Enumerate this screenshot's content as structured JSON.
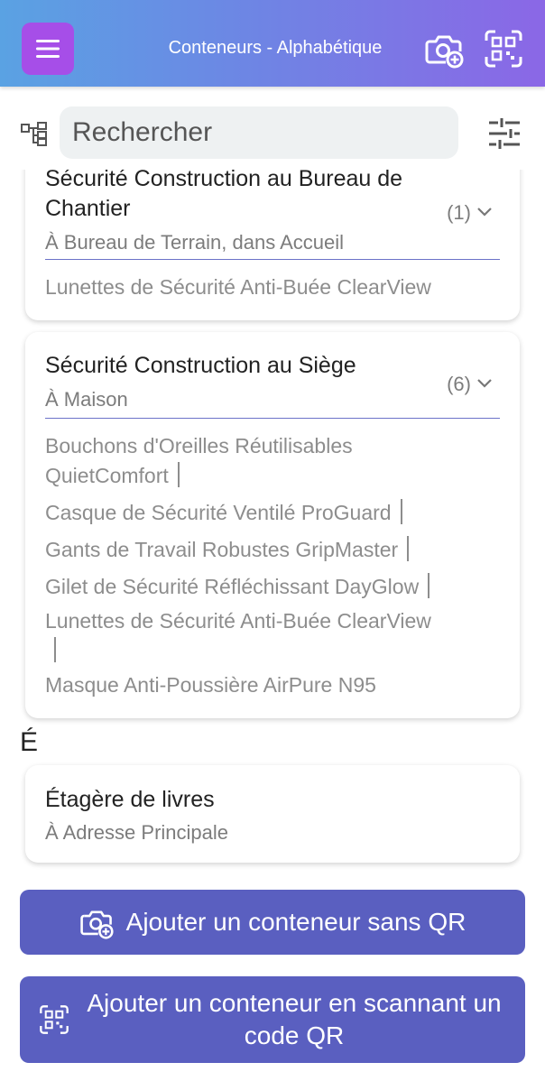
{
  "header": {
    "title": "Conteneurs - Alphabétique",
    "colors": {
      "gradient_start": "#5aa2e3",
      "gradient_end": "#8b67e6",
      "menu_button": "#a64ee8"
    },
    "icons": [
      "menu-icon",
      "camera-add-icon",
      "qr-scan-icon"
    ]
  },
  "search": {
    "placeholder": "Rechercher",
    "value": ""
  },
  "containers": [
    {
      "title": "Sécurité Construction au Bureau de Chantier",
      "location": "À Bureau de Terrain, dans Accueil",
      "count": "(1)",
      "items": [
        "Lunettes de Sécurité Anti-Buée ClearView"
      ]
    },
    {
      "title": "Sécurité Construction au Siège",
      "location": "À Maison",
      "count": "(6)",
      "items": [
        "Bouchons d'Oreilles Réutilisables QuietComfort",
        "Casque de Sécurité Ventilé ProGuard",
        "Gants de Travail Robustes GripMaster",
        "Gilet de Sécurité Réfléchissant DayGlow",
        "Lunettes de Sécurité Anti-Buée ClearView",
        "Masque Anti-Poussière AirPure N95"
      ]
    }
  ],
  "section_e": {
    "letter": "É",
    "containers": [
      {
        "title": "Étagère de livres",
        "location": "À Adresse Principale"
      }
    ]
  },
  "actions": {
    "add_without_qr": "Ajouter un conteneur sans QR",
    "add_with_qr": "Ajouter un conteneur en scannant un code QR",
    "button_color": "#5a5fc0"
  }
}
